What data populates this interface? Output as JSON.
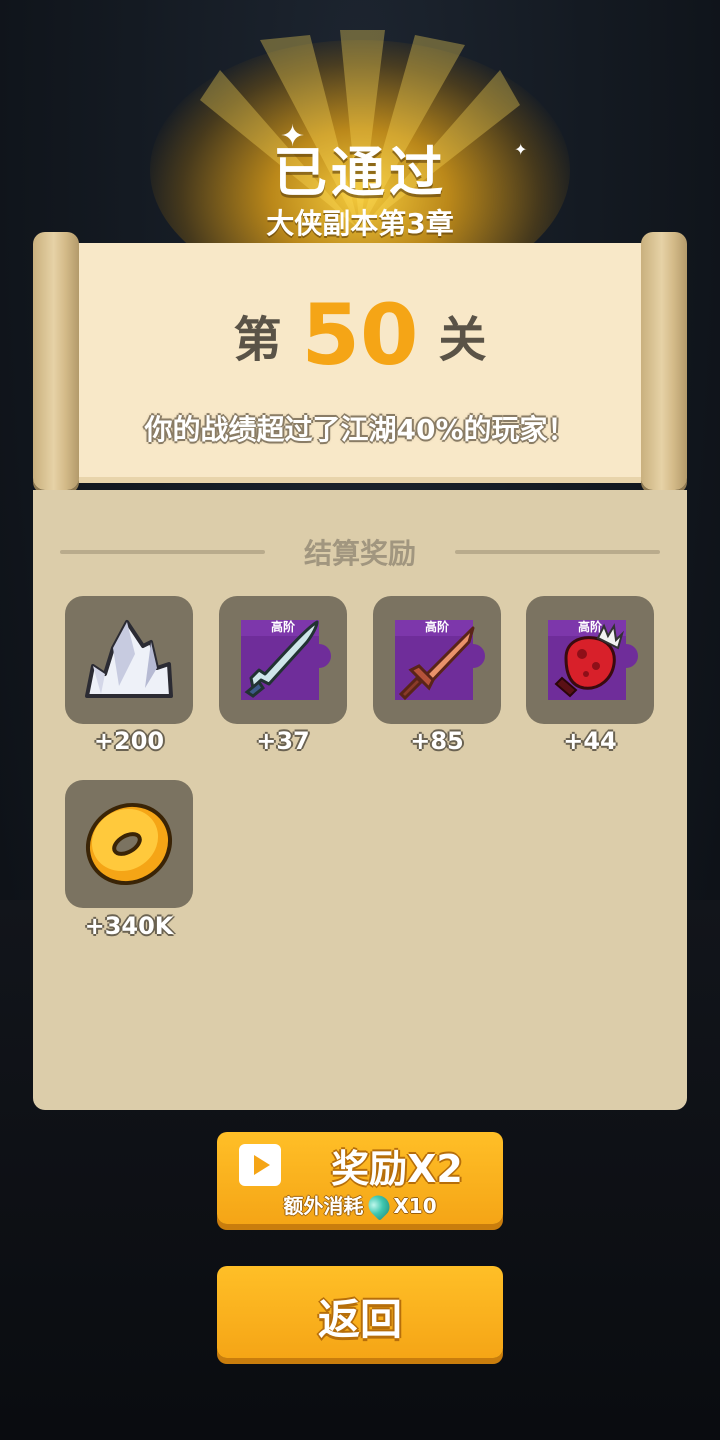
{
  "header": {
    "title": "已通过",
    "subtitle": "大侠副本第3章"
  },
  "stage": {
    "prefix": "第",
    "number": "50",
    "suffix": "关",
    "rank_text": "你的战绩超过了江湖40%的玩家！"
  },
  "rewards": {
    "section_title": "结算奖励",
    "items": [
      {
        "icon": "crystal-icon",
        "count": "+200"
      },
      {
        "icon": "blade-shard-icon",
        "tier": "高阶",
        "count": "+37"
      },
      {
        "icon": "sword-shard-icon",
        "tier": "高阶",
        "count": "+85"
      },
      {
        "icon": "gauntlet-shard-icon",
        "tier": "高阶",
        "count": "+44"
      },
      {
        "icon": "coin-icon",
        "count": "+340K"
      }
    ]
  },
  "buttons": {
    "double_label": "奖励X2",
    "double_cost_text": "额外消耗",
    "double_cost_amount": "X10",
    "back_label": "返回"
  },
  "colors": {
    "accent": "#f5a516",
    "panel": "#dccdaa",
    "paper": "#f8e8c8",
    "slot": "#7b7361",
    "shard_bg": "#6f2d9a"
  }
}
